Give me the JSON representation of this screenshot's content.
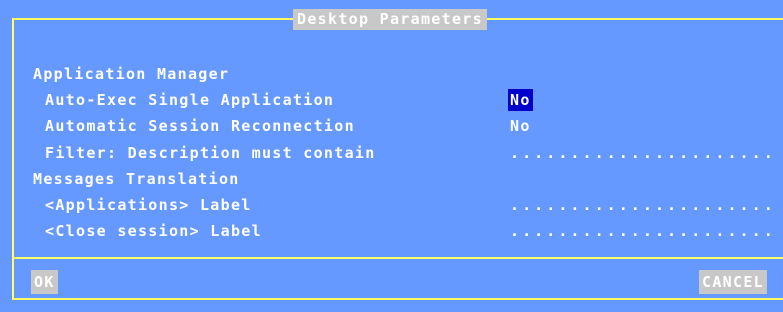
{
  "dialog": {
    "title": "Desktop Parameters"
  },
  "sections": {
    "app_manager": "Application Manager",
    "messages_translation": "Messages Translation"
  },
  "fields": {
    "auto_exec": {
      "label": "Auto-Exec Single Application",
      "value": "No"
    },
    "auto_reconnect": {
      "label": "Automatic Session Reconnection",
      "value": "No"
    },
    "filter": {
      "label": "Filter: Description must contain",
      "value": "......................"
    },
    "applications_label": {
      "label": "<Applications> Label",
      "value": "......................"
    },
    "close_session_label": {
      "label": "<Close session> Label",
      "value": "......................"
    }
  },
  "buttons": {
    "ok": "OK",
    "cancel": "CANCEL"
  },
  "colors": {
    "background": "#6699ff",
    "frame": "#ffff66",
    "button_bg": "#c8c8c8",
    "selection": "#0000cc",
    "text": "#ffffff"
  }
}
